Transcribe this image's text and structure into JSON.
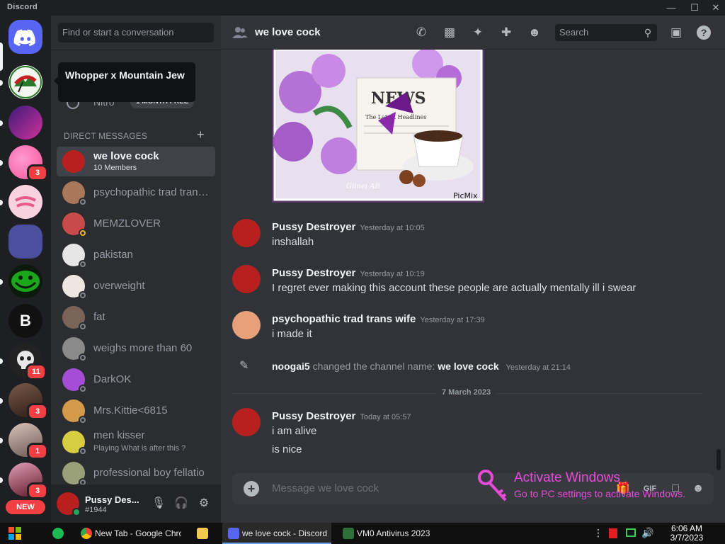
{
  "window": {
    "app_name": "Discord"
  },
  "tooltip": {
    "text": "Whopper x Mountain Jew"
  },
  "guild_bar": {
    "badges": [
      "3",
      "11",
      "3",
      "1",
      "3"
    ],
    "new_label": "NEW",
    "bitcoin_glyph": "B"
  },
  "dm_sidebar": {
    "search_placeholder": "Find or start a conversation",
    "nitro_label": "Nitro",
    "nitro_pill": "1 MONTH FREE",
    "section_label": "DIRECT MESSAGES",
    "add_label": "+",
    "items": [
      {
        "name": "we love cock",
        "sub": "10 Members"
      },
      {
        "name": "psychopathic trad trans wife",
        "sub": ""
      },
      {
        "name": "MEMZLOVER",
        "sub": ""
      },
      {
        "name": "pakistan",
        "sub": ""
      },
      {
        "name": "overweight",
        "sub": ""
      },
      {
        "name": "fat",
        "sub": ""
      },
      {
        "name": "weighs more than 60",
        "sub": ""
      },
      {
        "name": "DarkOK",
        "sub": ""
      },
      {
        "name": "Mrs.Kittie<6815",
        "sub": ""
      },
      {
        "name": "men kisser",
        "sub": "Playing What is after this ?"
      },
      {
        "name": "professional boy fellatio",
        "sub": ""
      }
    ]
  },
  "user_panel": {
    "name": "Pussy Des...",
    "tag": "#1944"
  },
  "channel": {
    "name": "we love cock",
    "search_placeholder": "Search",
    "image_caption": "PicMix",
    "image_headline": "The Latest Headlines",
    "image_news": "NEWS",
    "image_signature": "Gilnei AB"
  },
  "messages": [
    {
      "author": "Pussy Destroyer",
      "time": "Yesterday at 10:05",
      "lines": [
        "inshallah"
      ]
    },
    {
      "author": "Pussy Destroyer",
      "time": "Yesterday at 10:19",
      "lines": [
        "I regret ever making this account these people are actually mentally ill i swear"
      ]
    },
    {
      "author": "psychopathic trad trans wife",
      "time": "Yesterday at 17:39",
      "lines": [
        "i made it"
      ]
    },
    {
      "author": "Pussy Destroyer",
      "time": "Today at 05:57",
      "lines": [
        "i am alive",
        "is nice"
      ]
    }
  ],
  "system_message": {
    "actor": "noogai5",
    "action": "changed the channel name:",
    "new_name": "we love cock",
    "time": "Yesterday at 21:14"
  },
  "date_divider": "7 March 2023",
  "composer": {
    "placeholder": "Message we love cock",
    "gif_label": "GIF"
  },
  "watermark": {
    "title": "Activate Windows",
    "subtitle": "Go to PC settings to activate Windows."
  },
  "taskbar": {
    "apps": [
      {
        "label": "New Tab - Google Chrome"
      },
      {
        "label": "we love cock - Discord"
      },
      {
        "label": "VM0 Antivirus 2023"
      }
    ],
    "time": "6:06 AM",
    "date": "3/7/2023"
  },
  "colors": {
    "accent": "#5865f2",
    "badge": "#f23f43",
    "watermark": "#e94bd9"
  }
}
